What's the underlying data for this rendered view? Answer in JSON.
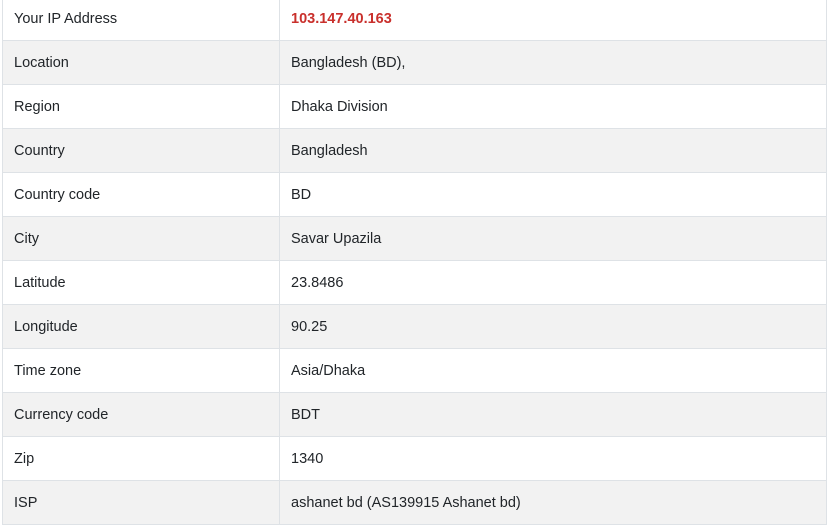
{
  "ip_info": {
    "highlight_color": "#c9302c",
    "rows": [
      {
        "label": "Your IP Address",
        "value": "103.147.40.163"
      },
      {
        "label": "Location",
        "value": "Bangladesh (BD),"
      },
      {
        "label": "Region",
        "value": "Dhaka Division"
      },
      {
        "label": "Country",
        "value": "Bangladesh"
      },
      {
        "label": "Country code",
        "value": "BD"
      },
      {
        "label": "City",
        "value": "Savar Upazila"
      },
      {
        "label": "Latitude",
        "value": "23.8486"
      },
      {
        "label": "Longitude",
        "value": "90.25"
      },
      {
        "label": "Time zone",
        "value": "Asia/Dhaka"
      },
      {
        "label": "Currency code",
        "value": "BDT"
      },
      {
        "label": "Zip",
        "value": "1340"
      },
      {
        "label": "ISP",
        "value": "ashanet bd (AS139915 Ashanet bd)"
      }
    ]
  }
}
